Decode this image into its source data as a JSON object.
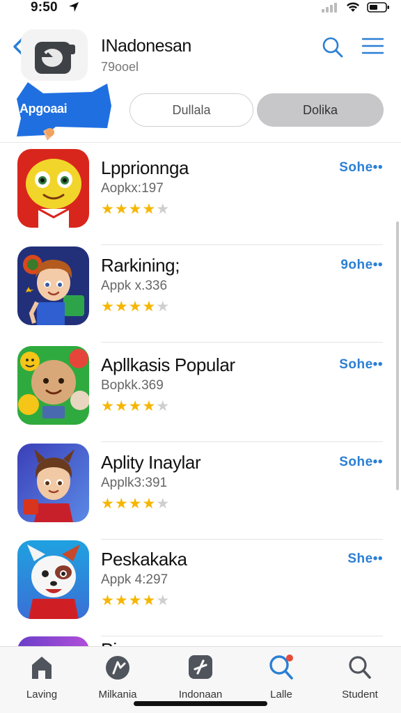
{
  "status_bar": {
    "time": "9:50"
  },
  "header": {
    "title": "INadonesan",
    "subtitle": "79ooel"
  },
  "filters": {
    "flag_label": "Apgoaai",
    "pill_1": "Dullala",
    "pill_2": "Dolika"
  },
  "apps": [
    {
      "title": "Lpprionnga",
      "meta": "Aopkx:197",
      "rating": 4,
      "action": "Sohe••"
    },
    {
      "title": "Rarkining;",
      "meta": "Appk x.336",
      "rating": 4,
      "action": "9ohe••"
    },
    {
      "title": "Apllkasis Popular",
      "meta": "Bopkk.369",
      "rating": 4,
      "action": "Sohe••"
    },
    {
      "title": "Aplity Inaylar",
      "meta": "Applk3:391",
      "rating": 4,
      "action": "Sohe••"
    },
    {
      "title": "Peskakaka",
      "meta": "Appk 4:297",
      "rating": 4,
      "action": "She••"
    }
  ],
  "partial_item": {
    "title": "Pi..."
  },
  "tabs": [
    {
      "label": "Laving",
      "icon": "home-icon"
    },
    {
      "label": "Milkania",
      "icon": "compass-icon"
    },
    {
      "label": "Indonaan",
      "icon": "games-icon"
    },
    {
      "label": "Lalle",
      "icon": "search-active-icon"
    },
    {
      "label": "Student",
      "icon": "search-icon"
    }
  ],
  "colors": {
    "accent": "#2a7fd4",
    "flag": "#1f6fe0",
    "star": "#f6b600",
    "pill_selected": "#c7c7c9"
  }
}
